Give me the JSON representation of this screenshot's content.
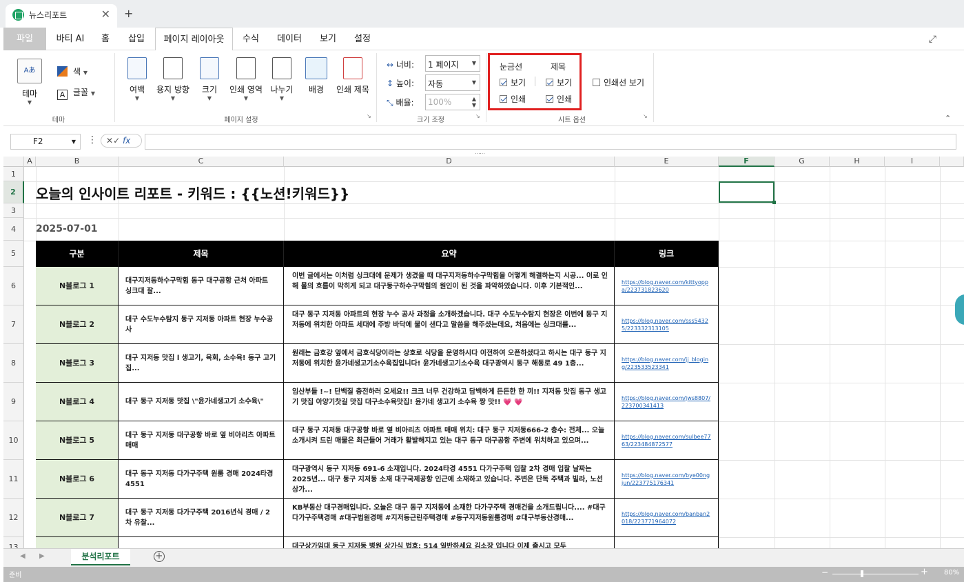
{
  "window": {
    "tab_title": "뉴스리포트",
    "close": "✕",
    "new_tab": "+"
  },
  "menu": [
    "파일",
    "바티 AI",
    "홈",
    "삽입",
    "페이지 레이아웃",
    "수식",
    "데이터",
    "보기",
    "설정"
  ],
  "ribbon": {
    "theme": {
      "theme_label": "테마",
      "color_label": "색",
      "font_label": "글꼴",
      "group": "테마"
    },
    "page_setup": {
      "buttons": [
        "여백",
        "용지 방향",
        "크기",
        "인쇄 영역",
        "나누기",
        "배경",
        "인쇄 제목"
      ],
      "group": "페이지 설정"
    },
    "scale": {
      "width_label": "너비:",
      "width_value": "1 페이지",
      "height_label": "높이:",
      "height_value": "자동",
      "scale_label": "배율:",
      "scale_value": "100%",
      "group": "크기 조정"
    },
    "sheet_options": {
      "gridlines_label": "눈금선",
      "headings_label": "제목",
      "view": "보기",
      "print": "인쇄",
      "page_break": "인쇄선 보기",
      "group": "시트 옵션"
    }
  },
  "formula_bar": {
    "name_box": "F2",
    "fx": "fx",
    "formula": ""
  },
  "columns": [
    "A",
    "B",
    "C",
    "D",
    "E",
    "F",
    "G",
    "H",
    "I"
  ],
  "rows": [
    "1",
    "2",
    "3",
    "4",
    "5",
    "6",
    "7",
    "8",
    "9",
    "10",
    "11",
    "12",
    "13"
  ],
  "sheet": {
    "title": "오늘의 인사이트 리포트 - 키워드 : {{노션!키워드}}",
    "date": "2025-07-01",
    "headers": [
      "구분",
      "제목",
      "요약",
      "링크"
    ],
    "records": [
      {
        "cat": "N블로그 1",
        "title": "대구지저동하수구막힘 동구 대구공항 근처 아파트 싱크대 잘...",
        "summary": "이번 글에서는 이처럼 싱크대에 문제가 생겼을 때 대구지저동하수구막힘을 어떻게 해결하는지 시공... 이로 인해 물의 흐름이 막히게 되고 대구동구하수구막힘의 원인이 된 것을 파악하였습니다. 이후 기본적인...",
        "link": "https://blog.naver.com/kittyoppa/223731823620"
      },
      {
        "cat": "N블로그 2",
        "title": "대구 수도누수탐지 동구 지저동 아파트 현장 누수공사",
        "summary": "대구 동구 지저동 아파트의 현장 누수 공사 과정을 소개하겠습니다. 대구 수도누수탐지 현장은 이번에 동구 지저동에 위치한 아파트 세대에 주방 바닥에 물이 샌다고 말씀을 해주셨는데요, 처음에는 싱크대를...",
        "link": "https://blog.naver.com/sss54325/223332313105"
      },
      {
        "cat": "N블로그 3",
        "title": "대구 지저동 맛집 l 생고기, 육회, 소수육! 동구 고기집...",
        "summary": "원래는 금호강 옆에서 금호식당이라는 상호로 식당을 운영하시다 이전하여 오픈하셨다고 하시는 대구 동구 지저동에 위치한 윤가네생고기소수육집입니다! 윤가네생고기소수육 대구광역시 동구 해동로 49 1층...",
        "link": "https://blog.naver.com/jj_bloging/223533523341"
      },
      {
        "cat": "N블로그 4",
        "title": "대구 동구 지저동 맛집 \\\"윤가네생고기 소수육\\\"",
        "summary": "임산부들 !~! 단백질 충전하러 오세요!! 크크 너무 건강하고 담백하게 든든한 한 끼!! 지저동 맛집 동구 생고기 맛집 아양기찻길 맛집 대구소수육맛집! 윤가네 생고기 소수육 짱 맛!! 💗 💗",
        "link": "https://blog.naver.com/jws8807/223700341413"
      },
      {
        "cat": "N블로그 5",
        "title": "대구 동구 지저동 대구공항 바로 옆 비아리츠 아파트 매매",
        "summary": "대구 동구 지저동 대구공항 바로 옆 비아리츠 아파트 매매 위치: 대구 동구 지저동666-2 층수: 전체... 오늘 소개시켜 드린 매물은 최근들어 거래가 활발해지고 있는 대구 동구 대구공항 주변에 위치하고 있으며...",
        "link": "https://blog.naver.com/sulbee7763/223484872577"
      },
      {
        "cat": "N블로그 6",
        "title": "대구 동구 지저동 다가구주택 원룸 경매 2024타경 4551",
        "summary": "대구광역시 동구 지저동 691-6 소재입니다. 2024타경 4551 다가구주택 입찰 2차 경매 입찰 날짜는 2025년... 대구 동구 지저동 소재 대구국제공항 인근에 소재하고 있습니다. 주변은 단독 주택과 빌라, 노선상가...",
        "link": "https://blog.naver.com/bye00ngjun/223775176341"
      },
      {
        "cat": "N블로그 7",
        "title": "대구 동구 지저동 다가구주택 2016년식 경매 / 2차 유찰...",
        "summary": "KB부동산 대구경매입니다. 오늘은 대구 동구 지저동에 소재한 다가구주택 경매건을 소개드립니다.... #대구다가구주택경매 #대구법원경매 #지저동근린주택경매 #동구지저동원룸경매 #대구부동산경매...",
        "link": "https://blog.naver.com/banban2018/223771964072"
      },
      {
        "cat": "",
        "title": "",
        "summary": "대구상가임대 동구 지저동 병원 상가식 법호: 514 일반하세요 김소장 입니다 이제 출시고 모두",
        "link": ""
      }
    ]
  },
  "sheet_tabs": {
    "active": "분석리포트",
    "add": "+"
  },
  "status": {
    "text": "준비",
    "zoom": "80%",
    "zoom_level_percent": 80
  },
  "colors": {
    "accent": "#217346",
    "highlight": "#e02020",
    "header_fill": "#000000",
    "category_fill": "#e3efd9"
  }
}
